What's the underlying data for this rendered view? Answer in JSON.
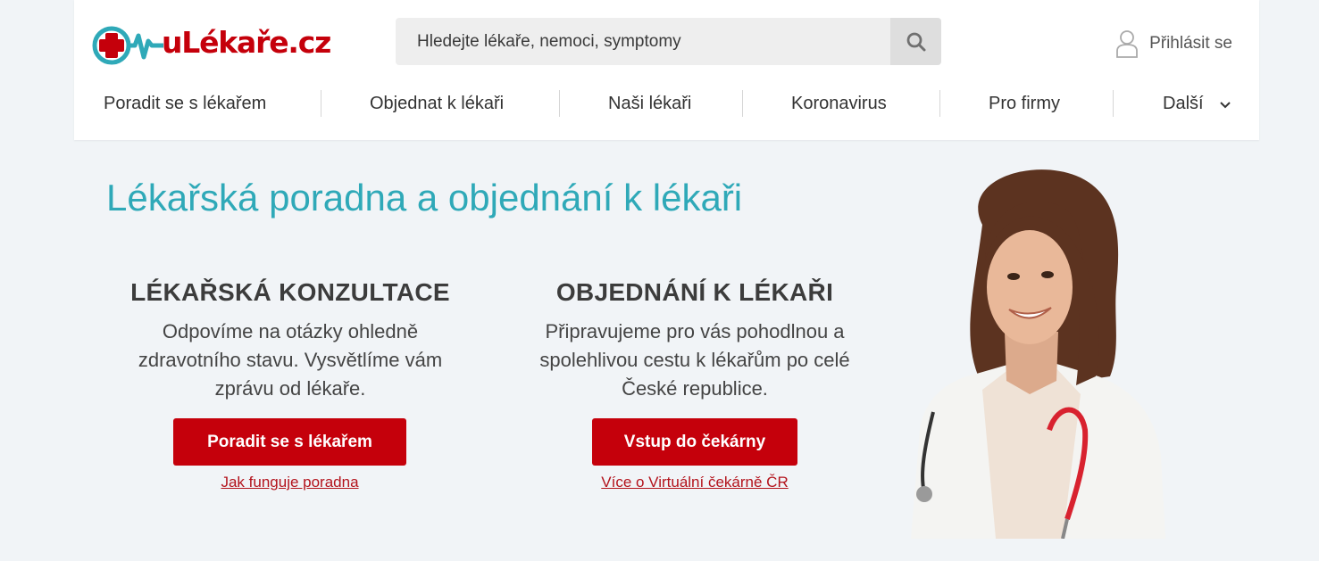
{
  "brand": {
    "name": "uLékaře.cz",
    "color": "#c5000b",
    "accent": "#2fa9b8"
  },
  "search": {
    "placeholder": "Hledejte lékaře, nemoci, symptomy",
    "icon": "search-icon"
  },
  "login": {
    "label": "Přihlásit se",
    "icon": "user-icon"
  },
  "nav": {
    "items": [
      {
        "label": "Poradit se s lékařem"
      },
      {
        "label": "Objednat k lékaři"
      },
      {
        "label": "Naši lékaři"
      },
      {
        "label": "Koronavirus"
      },
      {
        "label": "Pro firmy"
      },
      {
        "label": "Další",
        "icon": "chevron-down-icon"
      }
    ]
  },
  "hero": {
    "title": "Lékařská poradna a objednání k lékaři",
    "consultation": {
      "heading": "LÉKAŘSKÁ KONZULTACE",
      "text": "Odpovíme na otázky ohledně zdravotního stavu. Vysvětlíme vám zprávu od lékaře.",
      "button": "Poradit se s lékařem",
      "link": "Jak funguje poradna"
    },
    "booking": {
      "heading": "OBJEDNÁNÍ K LÉKAŘI",
      "text": "Připravujeme pro vás pohodlnou a spolehlivou cestu k lékařům po celé České republice.",
      "button": "Vstup do čekárny",
      "link": "Více o Virtuální čekárně ČR"
    }
  }
}
